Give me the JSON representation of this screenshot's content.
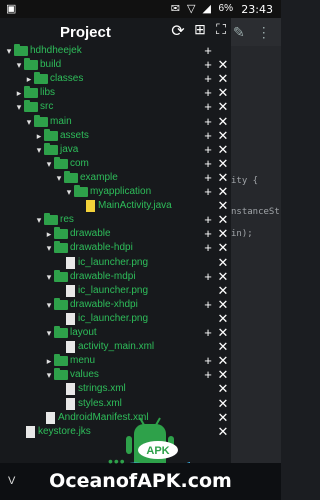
{
  "status": {
    "time": "23:43",
    "battery": "6%",
    "icons": "✉ ▽ ◢",
    "notif": "▣"
  },
  "panel": {
    "title": "Project"
  },
  "editor": {
    "lines": [
      "ity {",
      "nstanceSt",
      "in);"
    ]
  },
  "tree": [
    {
      "type": "folder",
      "label": "hdhdheejek",
      "level": 0,
      "open": true,
      "actions": "plus"
    },
    {
      "type": "folder",
      "label": "build",
      "level": 1,
      "open": true,
      "actions": "both"
    },
    {
      "type": "folder",
      "label": "classes",
      "level": 2,
      "open": false,
      "actions": "both"
    },
    {
      "type": "folder",
      "label": "libs",
      "level": 1,
      "open": false,
      "actions": "both"
    },
    {
      "type": "folder",
      "label": "src",
      "level": 1,
      "open": true,
      "actions": "both"
    },
    {
      "type": "folder",
      "label": "main",
      "level": 2,
      "open": true,
      "actions": "both"
    },
    {
      "type": "folder",
      "label": "assets",
      "level": 3,
      "open": false,
      "actions": "both"
    },
    {
      "type": "folder",
      "label": "java",
      "level": 3,
      "open": true,
      "actions": "both"
    },
    {
      "type": "folder",
      "label": "com",
      "level": 4,
      "open": true,
      "actions": "both"
    },
    {
      "type": "folder",
      "label": "example",
      "level": 5,
      "open": true,
      "actions": "both"
    },
    {
      "type": "folder",
      "label": "myapplication",
      "level": 6,
      "open": true,
      "actions": "both"
    },
    {
      "type": "java",
      "label": "MainActivity.java",
      "level": 7,
      "actions": "close"
    },
    {
      "type": "folder",
      "label": "res",
      "level": 3,
      "open": true,
      "actions": "both"
    },
    {
      "type": "folder",
      "label": "drawable",
      "level": 4,
      "open": false,
      "actions": "both"
    },
    {
      "type": "folder",
      "label": "drawable-hdpi",
      "level": 4,
      "open": true,
      "actions": "both"
    },
    {
      "type": "file",
      "label": "ic_launcher.png",
      "level": 5,
      "actions": "close"
    },
    {
      "type": "folder",
      "label": "drawable-mdpi",
      "level": 4,
      "open": true,
      "actions": "both"
    },
    {
      "type": "file",
      "label": "ic_launcher.png",
      "level": 5,
      "actions": "close"
    },
    {
      "type": "folder",
      "label": "drawable-xhdpi",
      "level": 4,
      "open": true,
      "actions": "both"
    },
    {
      "type": "file",
      "label": "ic_launcher.png",
      "level": 5,
      "actions": "close"
    },
    {
      "type": "folder",
      "label": "layout",
      "level": 4,
      "open": true,
      "actions": "both"
    },
    {
      "type": "file",
      "label": "activity_main.xml",
      "level": 5,
      "actions": "close"
    },
    {
      "type": "folder",
      "label": "menu",
      "level": 4,
      "open": false,
      "actions": "both"
    },
    {
      "type": "folder",
      "label": "values",
      "level": 4,
      "open": true,
      "actions": "both"
    },
    {
      "type": "file",
      "label": "strings.xml",
      "level": 5,
      "actions": "close"
    },
    {
      "type": "file",
      "label": "styles.xml",
      "level": 5,
      "actions": "close"
    },
    {
      "type": "file",
      "label": "AndroidManifest.xml",
      "level": 3,
      "actions": "close"
    },
    {
      "type": "file",
      "label": "keystore.jks",
      "level": 1,
      "actions": "close"
    }
  ],
  "bottom": {
    "left_label": "V",
    "dots": "•••"
  },
  "watermark": {
    "text": "OceanofAPK.com",
    "badge": "APK"
  }
}
